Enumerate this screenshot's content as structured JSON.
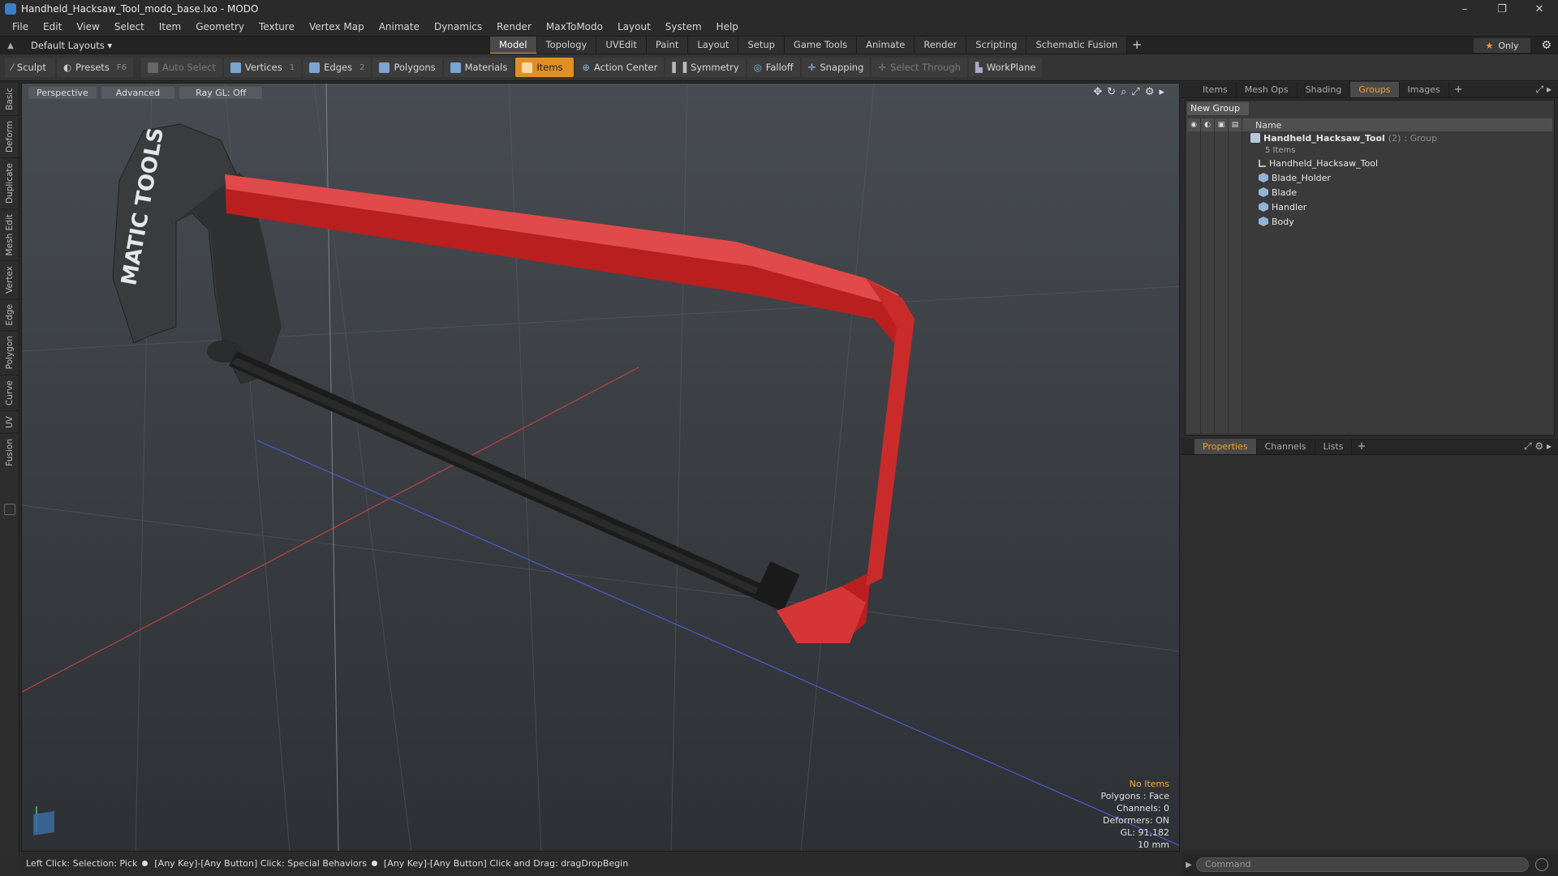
{
  "window": {
    "title": "Handheld_Hacksaw_Tool_modo_base.lxo - MODO",
    "buttons": [
      "–",
      "❐",
      "✕"
    ]
  },
  "menu": [
    "File",
    "Edit",
    "View",
    "Select",
    "Item",
    "Geometry",
    "Texture",
    "Vertex Map",
    "Animate",
    "Dynamics",
    "Render",
    "MaxToModo",
    "Layout",
    "System",
    "Help"
  ],
  "layout": {
    "selector": "Default Layouts ▾",
    "tabs": [
      "Model",
      "Topology",
      "UVEdit",
      "Paint",
      "Layout",
      "Setup",
      "Game Tools",
      "Animate",
      "Render",
      "Scripting",
      "Schematic Fusion"
    ],
    "active_tab": "Model",
    "add_tab": "+",
    "only_label": "Only"
  },
  "toolbar": {
    "sculpt": "Sculpt",
    "presets": "Presets",
    "presets_key": "F6",
    "auto_select": "Auto Select",
    "vertices": "Vertices",
    "vertices_count": "1",
    "edges": "Edges",
    "edges_count": "2",
    "polygons": "Polygons",
    "materials": "Materials",
    "items": "Items",
    "action_center": "Action Center",
    "symmetry": "Symmetry",
    "falloff": "Falloff",
    "snapping": "Snapping",
    "select_through": "Select Through",
    "workplane": "WorkPlane"
  },
  "left_tabs": [
    "Basic",
    "Deform",
    "Duplicate",
    "Mesh Edit",
    "Vertex",
    "Edge",
    "Polygon",
    "Curve",
    "UV",
    "Fusion"
  ],
  "viewport": {
    "view_mode": "Perspective",
    "shading": "Advanced",
    "raygl": "Ray GL: Off",
    "logo_text": "MATIC TOOLS",
    "info": {
      "selection": "No Items",
      "polygons": "Polygons : Face",
      "channels": "Channels: 0",
      "deformers": "Deformers: ON",
      "gl": "GL: 91,182",
      "units": "10 mm"
    }
  },
  "status": {
    "part1": "Left Click: Selection: Pick",
    "part2": "[Any Key]-[Any Button] Click: Special Behaviors",
    "part3": "[Any Key]-[Any Button] Click and Drag: dragDropBegin"
  },
  "top_panel": {
    "tabs": [
      "Items",
      "Mesh Ops",
      "Shading",
      "Groups",
      "Images"
    ],
    "active_tab": "Groups",
    "new_group": "New Group",
    "name_header": "Name",
    "group": {
      "name": "Handheld_Hacksaw_Tool",
      "count": "(2)",
      "type": ": Group",
      "sub": "5 Items"
    },
    "items": [
      "Handheld_Hacksaw_Tool",
      "Blade_Holder",
      "Blade",
      "Handler",
      "Body"
    ]
  },
  "bottom_panel": {
    "tabs": [
      "Properties",
      "Channels",
      "Lists"
    ],
    "active_tab": "Properties"
  },
  "command": {
    "placeholder": "Command"
  },
  "colors": {
    "accent": "#f0a030",
    "frame_red": "#d42a2a",
    "handle_dark": "#3a3b3d"
  }
}
